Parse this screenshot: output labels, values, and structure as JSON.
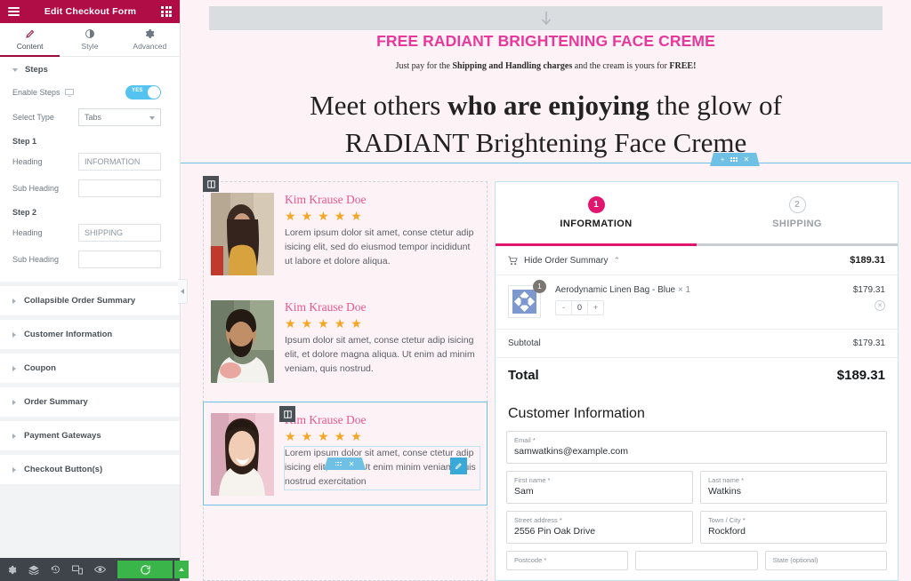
{
  "panel": {
    "header": {
      "title": "Edit Checkout Form",
      "menu_icon": "hamburger-icon",
      "apps_icon": "grid-apps-icon"
    },
    "tabs": [
      {
        "id": "content",
        "label": "Content",
        "icon": "pencil-icon",
        "active": true
      },
      {
        "id": "style",
        "label": "Style",
        "icon": "contrast-icon",
        "active": false
      },
      {
        "id": "advanced",
        "label": "Advanced",
        "icon": "gear-icon",
        "active": false
      }
    ],
    "steps_section": {
      "title": "Steps",
      "enable_steps_label": "Enable Steps",
      "enable_steps_value": "YES",
      "responsive_icon": "desktop-icon",
      "select_type_label": "Select Type",
      "select_type_value": "Tabs",
      "step1_label": "Step 1",
      "step1_heading_label": "Heading",
      "step1_heading_value": "INFORMATION",
      "step1_subheading_label": "Sub Heading",
      "step1_subheading_value": "",
      "step2_label": "Step 2",
      "step2_heading_label": "Heading",
      "step2_heading_value": "SHIPPING",
      "step2_subheading_label": "Sub Heading",
      "step2_subheading_value": ""
    },
    "collapsed_sections": [
      "Collapsible Order Summary",
      "Customer Information",
      "Coupon",
      "Order Summary",
      "Payment Gateways",
      "Checkout Button(s)"
    ],
    "footer": {
      "icons": [
        "settings-gear-icon",
        "navigator-layers-icon",
        "history-icon",
        "responsive-mode-icon",
        "preview-eye-icon"
      ],
      "publish_icon": "update-circular-arrow-icon",
      "publish_more_icon": "caret-up-icon"
    },
    "collapse_handle_icon": "chevron-left-icon"
  },
  "canvas": {
    "hero": {
      "drop_arrow_icon": "down-arrow-icon",
      "title": "FREE RADIANT BRIGHTENING FACE CREME",
      "subtitle_pre": "Just pay for the ",
      "subtitle_bold": "Shipping and Handling charges",
      "subtitle_mid": " and the cream is yours for ",
      "subtitle_bold2": "FREE!",
      "heading_line1_pre": "Meet others ",
      "heading_line1_bold": "who are enjoying",
      "heading_line1_post": " the glow of",
      "heading_line2": "RADIANT Brightening Face Creme"
    },
    "section_handle": {
      "add_icon": "plus-icon",
      "drag_icon": "dots-grid-icon",
      "close_icon": "close-x-icon"
    },
    "widget_handle": {
      "drag_icon": "dots-grid-icon",
      "close_icon": "close-x-icon",
      "edit_icon": "pencil-edit-icon"
    },
    "column_handle_icon": "column-widget-icon",
    "testimonials": [
      {
        "name": "Kim Krause Doe",
        "stars": 5,
        "text": "Lorem ipsum dolor sit amet, conse ctetur adip isicing elit, sed do eiusmod tempor incididunt ut labore et dolore aliqua.",
        "photo": "woman-long-dark-hair-photo",
        "selected": false
      },
      {
        "name": "Kim Krause Doe",
        "stars": 5,
        "text": "Ipsum dolor sit amet, conse ctetur adip isicing elit, et dolore magna aliqua. Ut enim ad minim veniam, quis nostrud.",
        "photo": "bearded-man-photo",
        "selected": false
      },
      {
        "name": "Kim Krause Doe",
        "stars": 5,
        "text": "Lorem ipsum dolor sit amet, conse ctetur adip isicing elit, sed do Ut enim minim veniam, quis nostrud exercitation",
        "photo": "smiling-woman-photo",
        "selected": true
      }
    ],
    "checkout": {
      "steps": [
        {
          "number": "1",
          "label": "INFORMATION",
          "active": true
        },
        {
          "number": "2",
          "label": "SHIPPING",
          "active": false
        }
      ],
      "summary_toggle": {
        "cart_icon": "cart-icon",
        "label": "Hide Order Summary",
        "chevron_icon": "chevron-up-icon",
        "amount": "$189.31"
      },
      "product": {
        "thumb_icon": "product-placeholder-icon",
        "qty_badge": "1",
        "name": "Aerodynamic Linen Bag - Blue",
        "name_qty": "× 1",
        "price": "$179.31",
        "stepper": {
          "minus": "-",
          "value": "0",
          "plus": "+"
        },
        "remove_icon": "remove-x-icon"
      },
      "subtotal_label": "Subtotal",
      "subtotal_value": "$179.31",
      "total_label": "Total",
      "total_value": "$189.31",
      "customer_info_title": "Customer Information",
      "fields": [
        [
          {
            "label": "Email *",
            "value": "samwatkins@example.com",
            "name": "email-field"
          }
        ],
        [
          {
            "label": "First name *",
            "value": "Sam",
            "name": "first-name-field"
          },
          {
            "label": "Last name *",
            "value": "Watkins",
            "name": "last-name-field"
          }
        ],
        [
          {
            "label": "Street address *",
            "value": "2556 Pin Oak Drive",
            "name": "street-address-field"
          },
          {
            "label": "Town / City *",
            "value": "Rockford",
            "name": "town-city-field"
          }
        ],
        [
          {
            "label": "Postcode *",
            "value": "",
            "name": "postcode-field"
          },
          {
            "label": "",
            "value": "",
            "name": "country-field"
          },
          {
            "label": "State (optional)",
            "value": "",
            "name": "state-field"
          }
        ]
      ]
    }
  },
  "colors": {
    "brand_maroon": "#b00c45",
    "accent_pink": "#e0166f",
    "hero_pink": "#e6399b",
    "elementor_blue": "#6ec1e4",
    "publish_green": "#39b54a",
    "toggle_blue": "#55c3f0",
    "star_orange": "#f5a623",
    "page_bg": "#fdf2f6"
  }
}
